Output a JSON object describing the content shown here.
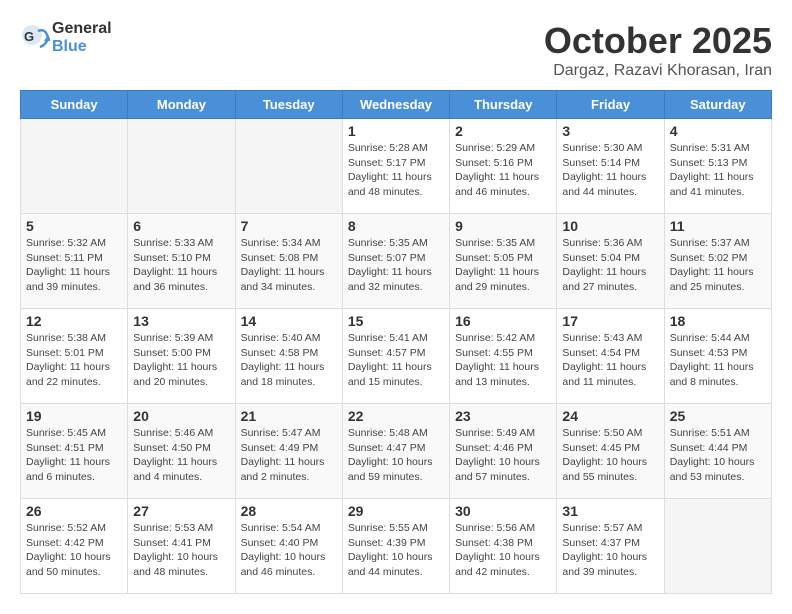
{
  "header": {
    "logo_general": "General",
    "logo_blue": "Blue",
    "month_title": "October 2025",
    "location": "Dargaz, Razavi Khorasan, Iran"
  },
  "days_of_week": [
    "Sunday",
    "Monday",
    "Tuesday",
    "Wednesday",
    "Thursday",
    "Friday",
    "Saturday"
  ],
  "weeks": [
    {
      "days": [
        {
          "number": "",
          "info": ""
        },
        {
          "number": "",
          "info": ""
        },
        {
          "number": "",
          "info": ""
        },
        {
          "number": "1",
          "info": "Sunrise: 5:28 AM\nSunset: 5:17 PM\nDaylight: 11 hours and 48 minutes."
        },
        {
          "number": "2",
          "info": "Sunrise: 5:29 AM\nSunset: 5:16 PM\nDaylight: 11 hours and 46 minutes."
        },
        {
          "number": "3",
          "info": "Sunrise: 5:30 AM\nSunset: 5:14 PM\nDaylight: 11 hours and 44 minutes."
        },
        {
          "number": "4",
          "info": "Sunrise: 5:31 AM\nSunset: 5:13 PM\nDaylight: 11 hours and 41 minutes."
        }
      ]
    },
    {
      "days": [
        {
          "number": "5",
          "info": "Sunrise: 5:32 AM\nSunset: 5:11 PM\nDaylight: 11 hours and 39 minutes."
        },
        {
          "number": "6",
          "info": "Sunrise: 5:33 AM\nSunset: 5:10 PM\nDaylight: 11 hours and 36 minutes."
        },
        {
          "number": "7",
          "info": "Sunrise: 5:34 AM\nSunset: 5:08 PM\nDaylight: 11 hours and 34 minutes."
        },
        {
          "number": "8",
          "info": "Sunrise: 5:35 AM\nSunset: 5:07 PM\nDaylight: 11 hours and 32 minutes."
        },
        {
          "number": "9",
          "info": "Sunrise: 5:35 AM\nSunset: 5:05 PM\nDaylight: 11 hours and 29 minutes."
        },
        {
          "number": "10",
          "info": "Sunrise: 5:36 AM\nSunset: 5:04 PM\nDaylight: 11 hours and 27 minutes."
        },
        {
          "number": "11",
          "info": "Sunrise: 5:37 AM\nSunset: 5:02 PM\nDaylight: 11 hours and 25 minutes."
        }
      ]
    },
    {
      "days": [
        {
          "number": "12",
          "info": "Sunrise: 5:38 AM\nSunset: 5:01 PM\nDaylight: 11 hours and 22 minutes."
        },
        {
          "number": "13",
          "info": "Sunrise: 5:39 AM\nSunset: 5:00 PM\nDaylight: 11 hours and 20 minutes."
        },
        {
          "number": "14",
          "info": "Sunrise: 5:40 AM\nSunset: 4:58 PM\nDaylight: 11 hours and 18 minutes."
        },
        {
          "number": "15",
          "info": "Sunrise: 5:41 AM\nSunset: 4:57 PM\nDaylight: 11 hours and 15 minutes."
        },
        {
          "number": "16",
          "info": "Sunrise: 5:42 AM\nSunset: 4:55 PM\nDaylight: 11 hours and 13 minutes."
        },
        {
          "number": "17",
          "info": "Sunrise: 5:43 AM\nSunset: 4:54 PM\nDaylight: 11 hours and 11 minutes."
        },
        {
          "number": "18",
          "info": "Sunrise: 5:44 AM\nSunset: 4:53 PM\nDaylight: 11 hours and 8 minutes."
        }
      ]
    },
    {
      "days": [
        {
          "number": "19",
          "info": "Sunrise: 5:45 AM\nSunset: 4:51 PM\nDaylight: 11 hours and 6 minutes."
        },
        {
          "number": "20",
          "info": "Sunrise: 5:46 AM\nSunset: 4:50 PM\nDaylight: 11 hours and 4 minutes."
        },
        {
          "number": "21",
          "info": "Sunrise: 5:47 AM\nSunset: 4:49 PM\nDaylight: 11 hours and 2 minutes."
        },
        {
          "number": "22",
          "info": "Sunrise: 5:48 AM\nSunset: 4:47 PM\nDaylight: 10 hours and 59 minutes."
        },
        {
          "number": "23",
          "info": "Sunrise: 5:49 AM\nSunset: 4:46 PM\nDaylight: 10 hours and 57 minutes."
        },
        {
          "number": "24",
          "info": "Sunrise: 5:50 AM\nSunset: 4:45 PM\nDaylight: 10 hours and 55 minutes."
        },
        {
          "number": "25",
          "info": "Sunrise: 5:51 AM\nSunset: 4:44 PM\nDaylight: 10 hours and 53 minutes."
        }
      ]
    },
    {
      "days": [
        {
          "number": "26",
          "info": "Sunrise: 5:52 AM\nSunset: 4:42 PM\nDaylight: 10 hours and 50 minutes."
        },
        {
          "number": "27",
          "info": "Sunrise: 5:53 AM\nSunset: 4:41 PM\nDaylight: 10 hours and 48 minutes."
        },
        {
          "number": "28",
          "info": "Sunrise: 5:54 AM\nSunset: 4:40 PM\nDaylight: 10 hours and 46 minutes."
        },
        {
          "number": "29",
          "info": "Sunrise: 5:55 AM\nSunset: 4:39 PM\nDaylight: 10 hours and 44 minutes."
        },
        {
          "number": "30",
          "info": "Sunrise: 5:56 AM\nSunset: 4:38 PM\nDaylight: 10 hours and 42 minutes."
        },
        {
          "number": "31",
          "info": "Sunrise: 5:57 AM\nSunset: 4:37 PM\nDaylight: 10 hours and 39 minutes."
        },
        {
          "number": "",
          "info": ""
        }
      ]
    }
  ]
}
